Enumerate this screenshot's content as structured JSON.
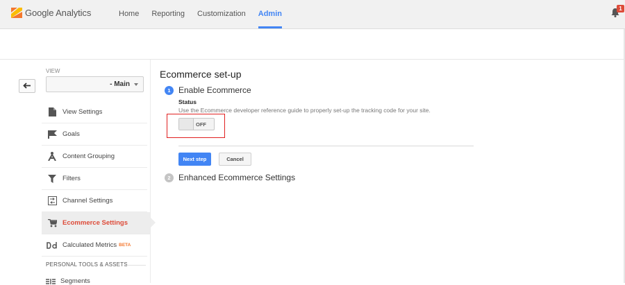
{
  "header": {
    "app_name": "Google Analytics",
    "logo_icon": "analytics-logo-icon",
    "nav": [
      {
        "label": "Home",
        "active": false
      },
      {
        "label": "Reporting",
        "active": false
      },
      {
        "label": "Customization",
        "active": false
      },
      {
        "label": "Admin",
        "active": true
      }
    ],
    "notification_count": "1",
    "colors": {
      "accent": "#4285f4",
      "alert": "#dd4b39",
      "logo_orange": "#f4772d",
      "logo_yellow": "#fbbc05"
    }
  },
  "sidebar": {
    "view_label": "VIEW",
    "view_select_value": "- Main",
    "items": [
      {
        "label": "View Settings",
        "icon": "document-icon",
        "active": false
      },
      {
        "label": "Goals",
        "icon": "flag-icon",
        "active": false
      },
      {
        "label": "Content Grouping",
        "icon": "grouping-icon",
        "active": false
      },
      {
        "label": "Filters",
        "icon": "filter-icon",
        "active": false
      },
      {
        "label": "Channel Settings",
        "icon": "channel-icon",
        "active": false
      },
      {
        "label": "Ecommerce Settings",
        "icon": "cart-icon",
        "active": true
      },
      {
        "label": "Calculated Metrics",
        "icon": "calculated-metrics-icon",
        "active": false,
        "badge": "BETA"
      }
    ],
    "section_heading": "PERSONAL TOOLS & ASSETS",
    "partial_item": {
      "label": "Segments",
      "icon": "segments-icon"
    }
  },
  "main": {
    "title": "Ecommerce set-up",
    "steps": [
      {
        "number": "1",
        "label": "Enable Ecommerce"
      },
      {
        "number": "2",
        "label": "Enhanced Ecommerce Settings"
      }
    ],
    "status_label": "Status",
    "status_description": "Use the Ecommerce developer reference guide to properly set-up the tracking code for your site.",
    "toggle_text": "OFF",
    "next_button": "Next step",
    "cancel_button": "Cancel"
  }
}
